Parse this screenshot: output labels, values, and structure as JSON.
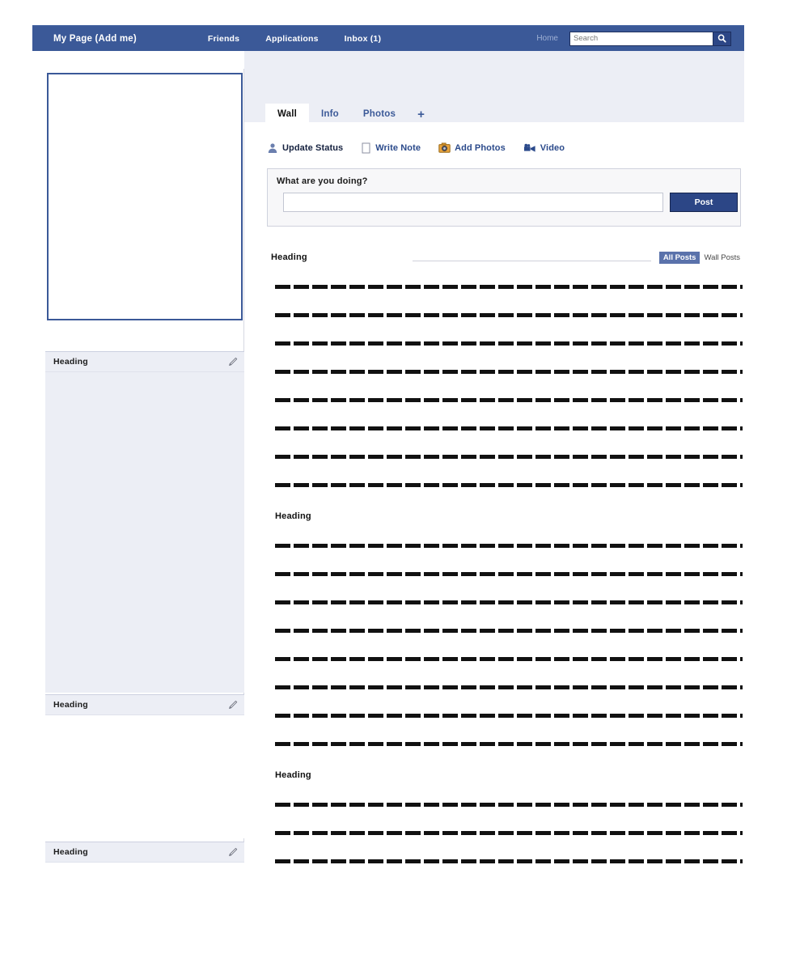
{
  "navbar": {
    "brand": "My Page (Add me)",
    "links": [
      "Friends",
      "Applications",
      "Inbox (1)"
    ],
    "home_label": "Home",
    "search_placeholder": "Search",
    "search_value": "",
    "search_icon": "magnifier-icon",
    "bar_color": "#3b5998"
  },
  "sidebar": {
    "photo_box": {
      "name": "profile-photo-placeholder",
      "border_color": "#3b5998"
    },
    "boxes": [
      {
        "title": "Heading",
        "edit_icon": "pencil-icon",
        "body": "filled"
      },
      {
        "title": "Heading",
        "edit_icon": "pencil-icon",
        "body": "empty"
      },
      {
        "title": "Heading",
        "edit_icon": "pencil-icon",
        "body": "empty"
      }
    ]
  },
  "main": {
    "tabs": [
      {
        "label": "Wall",
        "active": true
      },
      {
        "label": "Info",
        "active": false
      },
      {
        "label": "Photos",
        "active": false
      }
    ],
    "tab_add_label": "+",
    "actions": [
      {
        "label": "Update Status",
        "icon": "person-icon",
        "active": true
      },
      {
        "label": "Write Note",
        "icon": "note-icon",
        "active": false
      },
      {
        "label": "Add Photos",
        "icon": "camera-icon",
        "active": false
      },
      {
        "label": "Video",
        "icon": "video-camera-icon",
        "active": false
      }
    ],
    "composer": {
      "prompt": "What are you doing?",
      "input_value": "",
      "input_placeholder": "",
      "post_label": "Post"
    },
    "filter": {
      "heading": "Heading",
      "options": [
        {
          "label": "All Posts",
          "selected": true
        },
        {
          "label": "Wall Posts",
          "selected": false
        }
      ]
    },
    "feed": [
      {
        "heading": null,
        "lines": 8
      },
      {
        "heading": "Heading",
        "lines": 8
      },
      {
        "heading": "Heading",
        "lines": 3
      }
    ]
  }
}
